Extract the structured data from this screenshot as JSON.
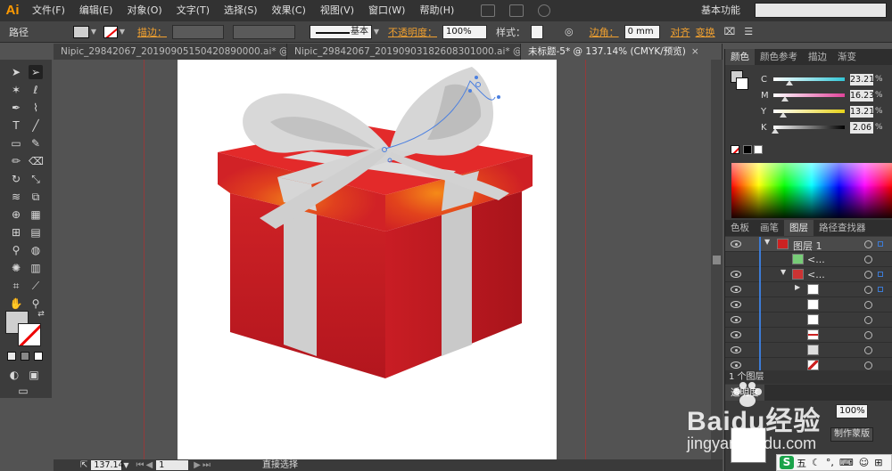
{
  "app": {
    "logo": "Ai"
  },
  "menu": {
    "items": [
      "文件(F)",
      "编辑(E)",
      "对象(O)",
      "文字(T)",
      "选择(S)",
      "效果(C)",
      "视图(V)",
      "窗口(W)",
      "帮助(H)"
    ]
  },
  "workspace": {
    "label": "基本功能"
  },
  "control": {
    "selection_type": "路径",
    "stroke_label": "描边：",
    "stroke_style": "基本",
    "opacity_label": "不透明度：",
    "opacity_value": "100%",
    "style_label": "样式：",
    "corner_label": "边角：",
    "corner_value": "0 mm",
    "align_label": "对齐",
    "transform_label": "变换"
  },
  "tabs": [
    {
      "label": "Nipic_29842067_20190905150420890000.ai* @ 143...",
      "close": "×"
    },
    {
      "label": "Nipic_29842067_20190903182608301000.ai* @ 124...",
      "close": "×"
    },
    {
      "label": "未标题-5* @ 137.14% (CMYK/预览)",
      "close": "×"
    }
  ],
  "status": {
    "zoom": "137.14",
    "page": "1",
    "tool": "直接选择"
  },
  "color_panel": {
    "tabs": [
      "颜色",
      "颜色参考",
      "描边",
      "渐变"
    ],
    "channels": [
      {
        "name": "C",
        "value": "23.21",
        "unit": "%",
        "level": 0.2321,
        "color": "#33c6d6"
      },
      {
        "name": "M",
        "value": "16.23",
        "unit": "%",
        "level": 0.1623,
        "color": "#e0449a"
      },
      {
        "name": "Y",
        "value": "13.21",
        "unit": "%",
        "level": 0.1321,
        "color": "#e6d21a"
      },
      {
        "name": "K",
        "value": "2.06",
        "unit": "%",
        "level": 0.0206,
        "color": "#222222"
      }
    ]
  },
  "layers_panel": {
    "tabs": [
      "色板",
      "画笔",
      "图层",
      "路径查找器"
    ],
    "layer_name": "图层 1",
    "group1": "<...",
    "group2": "<...",
    "footer": "1 个图层"
  },
  "transparency_panel": {
    "tab": "透明度",
    "value": "100%",
    "mask_button": "制作蒙版"
  },
  "watermark": {
    "brand": "Baidu经验",
    "url": "jingyan.baidu.com"
  },
  "ime": {
    "s": "S",
    "label": "五"
  }
}
